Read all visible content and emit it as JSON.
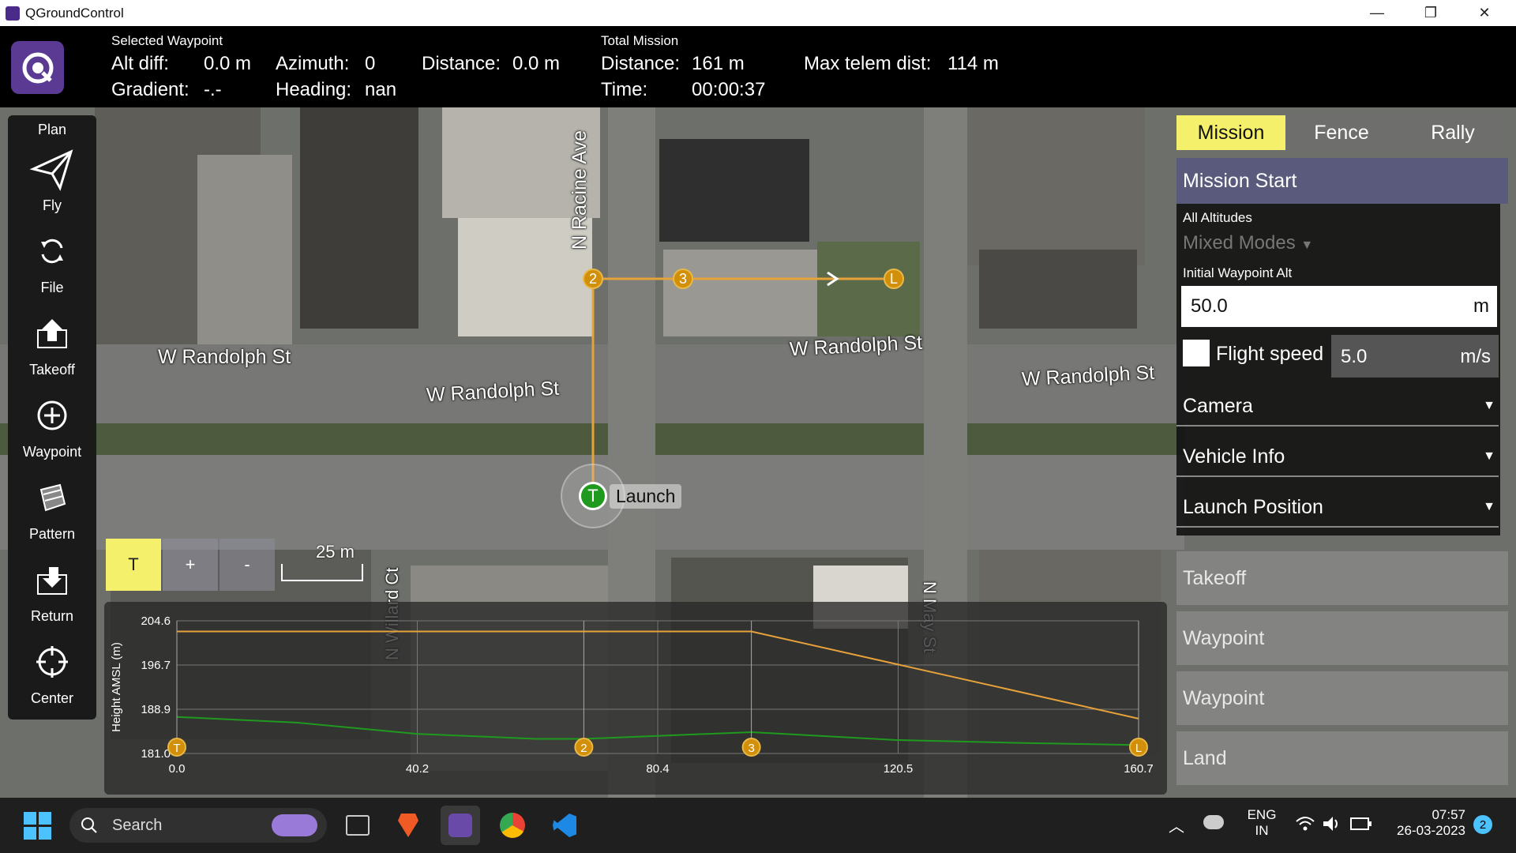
{
  "window": {
    "title": "QGroundControl",
    "minimize": "—",
    "restore": "❐",
    "close": "✕"
  },
  "toolbar": {
    "selected_waypoint": "Selected Waypoint",
    "alt_diff_label": "Alt diff:",
    "alt_diff_value": "0.0 m",
    "azimuth_label": "Azimuth:",
    "azimuth_value": "0",
    "distance_label": "Distance:",
    "distance_value": "0.0 m",
    "gradient_label": "Gradient:",
    "gradient_value": "-.-",
    "heading_label": "Heading:",
    "heading_value": "nan",
    "total_mission": "Total Mission",
    "total_distance_label": "Distance:",
    "total_distance_value": "161 m",
    "time_label": "Time:",
    "time_value": "00:00:37",
    "max_telem_label": "Max telem dist:",
    "max_telem_value": "114 m"
  },
  "leftbar": {
    "header": "Plan",
    "items": [
      {
        "label": "Fly",
        "icon": "paper-plane-icon"
      },
      {
        "label": "File",
        "icon": "sync-icon"
      },
      {
        "label": "Takeoff",
        "icon": "takeoff-arrow-icon"
      },
      {
        "label": "Waypoint",
        "icon": "plus-circle-icon"
      },
      {
        "label": "Pattern",
        "icon": "pattern-icon"
      },
      {
        "label": "Return",
        "icon": "return-icon"
      },
      {
        "label": "Center",
        "icon": "crosshair-icon"
      }
    ]
  },
  "map": {
    "streets": [
      "W Randolph St",
      "W Randolph St",
      "W Randolph St",
      "W Randolph St",
      "N Racine Ave",
      "N May St",
      "N Willard Ct"
    ],
    "waypoints": [
      "2",
      "3",
      "L"
    ],
    "launch_marker": "T",
    "launch_label": "Launch",
    "scale_label": "25 m",
    "controls": [
      "T",
      "+",
      "-"
    ]
  },
  "right_panel": {
    "tabs": [
      "Mission",
      "Fence",
      "Rally"
    ],
    "mission_start": "Mission Start",
    "all_altitudes": "All Altitudes",
    "altitude_mode": "Mixed Modes",
    "initial_wp_alt_label": "Initial Waypoint Alt",
    "initial_wp_alt_value": "50.0",
    "initial_wp_alt_unit": "m",
    "flight_speed_label": "Flight speed",
    "flight_speed_value": "5.0",
    "flight_speed_unit": "m/s",
    "sections": [
      "Camera",
      "Vehicle Info",
      "Launch Position"
    ],
    "items": [
      "Takeoff",
      "Waypoint",
      "Waypoint",
      "Land"
    ],
    "accent": "#f5f06b"
  },
  "chart_data": {
    "type": "line",
    "ylabel": "Height AMSL (m)",
    "ylim": [
      181.0,
      204.6
    ],
    "y_ticks": [
      "204.6",
      "196.7",
      "188.9",
      "181.0"
    ],
    "xlim": [
      0,
      160.7
    ],
    "x_ticks": [
      "0.0",
      "40.2",
      "80.4",
      "120.5",
      "160.7"
    ],
    "series": [
      {
        "color": "#e8a23a",
        "x": [
          0,
          68,
          96,
          160.7
        ],
        "y": [
          202.7,
          202.7,
          202.7,
          187.2
        ]
      },
      {
        "color": "#1f9a1f",
        "x": [
          0,
          20,
          40,
          60,
          68,
          96,
          120,
          140,
          160.7
        ],
        "y": [
          187.5,
          186.5,
          184.5,
          183.6,
          183.6,
          184.8,
          183.4,
          182.9,
          182.5
        ]
      }
    ],
    "markers": [
      {
        "label": "T",
        "x": 0
      },
      {
        "label": "2",
        "x": 68
      },
      {
        "label": "3",
        "x": 96
      },
      {
        "label": "L",
        "x": 160.7
      }
    ]
  },
  "taskbar": {
    "search_label": "Search",
    "lang_top": "ENG",
    "lang_bottom": "IN",
    "time": "07:57",
    "date": "26-03-2023",
    "notifications": "2"
  }
}
